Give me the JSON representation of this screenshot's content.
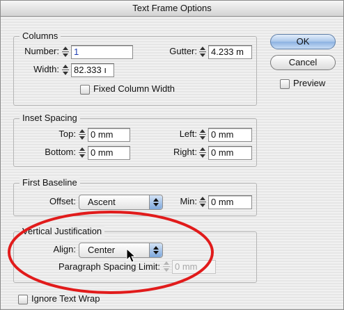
{
  "dialog": {
    "title": "Text Frame Options"
  },
  "columns": {
    "title": "Columns",
    "number_label": "Number:",
    "number_value": "1",
    "gutter_label": "Gutter:",
    "gutter_value": "4.233 m",
    "width_label": "Width:",
    "width_value": "82.333 ı",
    "fixed_width_label": "Fixed Column Width",
    "fixed_width_checked": false
  },
  "inset": {
    "title": "Inset Spacing",
    "top_label": "Top:",
    "top_value": "0 mm",
    "left_label": "Left:",
    "left_value": "0 mm",
    "bottom_label": "Bottom:",
    "bottom_value": "0 mm",
    "right_label": "Right:",
    "right_value": "0 mm"
  },
  "first_baseline": {
    "title": "First Baseline",
    "offset_label": "Offset:",
    "offset_value": "Ascent",
    "min_label": "Min:",
    "min_value": "0 mm"
  },
  "vertical_justification": {
    "title": "Vertical Justification",
    "align_label": "Align:",
    "align_value": "Center",
    "spacing_limit_label": "Paragraph Spacing Limit:",
    "spacing_limit_value": "0 mm"
  },
  "ignore_wrap": {
    "label": "Ignore Text Wrap",
    "checked": false
  },
  "buttons": {
    "ok": "OK",
    "cancel": "Cancel"
  },
  "preview": {
    "label": "Preview",
    "checked": false
  },
  "icons": {
    "stepper": "stepper-arrows-icon",
    "popup": "popup-arrows-icon",
    "cursor": "mouse-pointer-icon"
  },
  "colors": {
    "annotation": "#e11b1b",
    "default_button": "#8cb2e2",
    "number_value_text": "#1f3fb4"
  }
}
